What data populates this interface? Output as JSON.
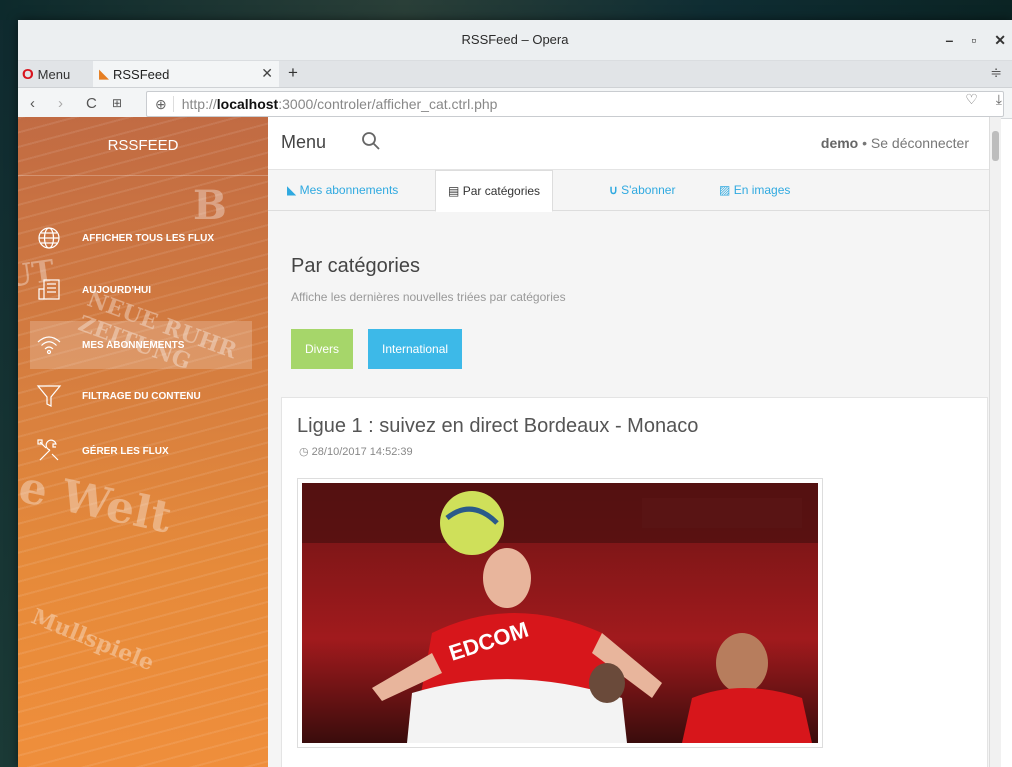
{
  "window": {
    "title": "RSSFeed – Opera"
  },
  "browser": {
    "menu_label": "Menu",
    "tab_title": "RSSFeed",
    "url_prefix": "http://",
    "url_host": "localhost",
    "url_rest": ":3000/controler/afficher_cat.ctrl.php"
  },
  "sidebar": {
    "brand": "RSSFEED",
    "items": [
      {
        "label": "AFFICHER TOUS LES FLUX",
        "icon": "globe-icon"
      },
      {
        "label": "AUJOURD'HUI",
        "icon": "newspaper-icon"
      },
      {
        "label": "MES ABONNEMENTS",
        "icon": "wifi-icon",
        "active": true
      },
      {
        "label": "FILTRAGE DU CONTENU",
        "icon": "filter-icon"
      },
      {
        "label": "GÉRER LES FLUX",
        "icon": "tools-icon"
      }
    ]
  },
  "topbar": {
    "menu": "Menu",
    "user": "demo",
    "separator": " • ",
    "logout": "Se déconnecter"
  },
  "tabs": [
    {
      "label": "Mes abonnements",
      "icon": "rss-icon"
    },
    {
      "label": "Par catégories",
      "icon": "newspaper-icon",
      "active": true
    },
    {
      "label": "S'abonner",
      "icon": "magnet-icon"
    },
    {
      "label": "En images",
      "icon": "image-icon"
    }
  ],
  "section": {
    "title": "Par catégories",
    "subtitle": "Affiche les dernières nouvelles triées par catégories"
  },
  "categories": [
    {
      "label": "Divers",
      "color": "#a6d66a"
    },
    {
      "label": "International",
      "color": "#3db9e8"
    }
  ],
  "article": {
    "title": "Ligue 1 : suivez en direct Bordeaux - Monaco",
    "date": "28/10/2017 14:52:39",
    "jersey_text": "EDCOM"
  }
}
